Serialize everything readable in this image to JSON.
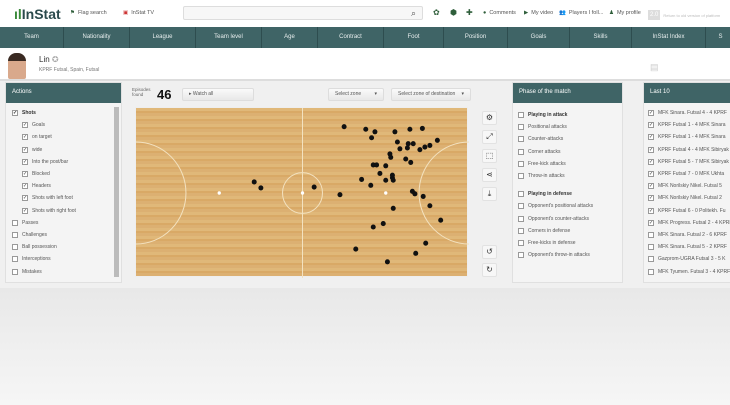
{
  "header": {
    "logo": "InStat",
    "flag_search": "Flag search",
    "instat_tv": "InStat TV",
    "comments": "Comments",
    "my_video": "My video",
    "players": "Players I foll...",
    "my_profile": "My profile",
    "return_old": "Return to old version of platform",
    "version_badge": "2.0"
  },
  "nav": [
    "Team",
    "Nationality",
    "League",
    "Team level",
    "Age",
    "Contract",
    "Foot",
    "Position",
    "Goals",
    "Skills",
    "InStat Index",
    "S"
  ],
  "player": {
    "name": "Lin",
    "club": "KPRF Futsal, Spain, Futsal"
  },
  "actions": {
    "title": "Actions",
    "items": [
      {
        "label": "Shots",
        "checked": true,
        "level": 0,
        "bold": true
      },
      {
        "label": "Goals",
        "checked": true,
        "level": 1
      },
      {
        "label": "on target",
        "checked": true,
        "level": 1
      },
      {
        "label": "wide",
        "checked": true,
        "level": 1
      },
      {
        "label": "Into the post/bar",
        "checked": true,
        "level": 1
      },
      {
        "label": "Blocked",
        "checked": true,
        "level": 1
      },
      {
        "label": "Headers",
        "checked": true,
        "level": 1
      },
      {
        "label": "Shots with left foot",
        "checked": true,
        "level": 1
      },
      {
        "label": "Shots with right foot",
        "checked": true,
        "level": 1
      },
      {
        "label": "Passes",
        "checked": false,
        "level": 0
      },
      {
        "label": "Challenges",
        "checked": false,
        "level": 0
      },
      {
        "label": "Ball possession",
        "checked": false,
        "level": 0
      },
      {
        "label": "Interceptions",
        "checked": false,
        "level": 0
      },
      {
        "label": "Mistakes",
        "checked": false,
        "level": 0
      }
    ]
  },
  "episodes": {
    "label": "Episodes found",
    "count": "46",
    "watch_all": "Watch all",
    "select_zone": "Select zone",
    "select_dest": "Select zone of destination"
  },
  "shots_m": [
    [
      25.0,
      2.2
    ],
    [
      27.6,
      2.5
    ],
    [
      28.7,
      2.8
    ],
    [
      28.3,
      3.5
    ],
    [
      31.1,
      2.8
    ],
    [
      32.9,
      2.5
    ],
    [
      34.4,
      2.4
    ],
    [
      36.2,
      3.8
    ],
    [
      35.3,
      4.4
    ],
    [
      34.7,
      4.6
    ],
    [
      34.1,
      4.9
    ],
    [
      33.3,
      4.2
    ],
    [
      32.7,
      4.2
    ],
    [
      32.6,
      4.7
    ],
    [
      31.7,
      4.8
    ],
    [
      31.4,
      4.0
    ],
    [
      30.5,
      5.4
    ],
    [
      30.6,
      5.8
    ],
    [
      32.4,
      6.0
    ],
    [
      33.0,
      6.4
    ],
    [
      28.5,
      6.7
    ],
    [
      28.9,
      6.7
    ],
    [
      30.0,
      6.8
    ],
    [
      29.3,
      7.7
    ],
    [
      27.1,
      8.4
    ],
    [
      28.2,
      9.1
    ],
    [
      30.0,
      8.5
    ],
    [
      30.8,
      8.2
    ],
    [
      30.9,
      8.5
    ],
    [
      21.4,
      9.3
    ],
    [
      24.5,
      10.2
    ],
    [
      33.2,
      9.8
    ],
    [
      33.5,
      10.1
    ],
    [
      34.5,
      10.4
    ],
    [
      35.3,
      11.5
    ],
    [
      30.9,
      11.8
    ],
    [
      36.6,
      13.2
    ],
    [
      29.7,
      13.6
    ],
    [
      28.5,
      14.0
    ],
    [
      34.8,
      15.9
    ],
    [
      33.6,
      17.1
    ],
    [
      26.4,
      16.6
    ],
    [
      30.2,
      18.1
    ],
    [
      14.2,
      8.7
    ],
    [
      15.0,
      9.4
    ],
    [
      30.8,
      7.9
    ]
  ],
  "phase": {
    "title": "Phase of the match",
    "items": [
      {
        "label": "Playing in attack",
        "bold": true
      },
      {
        "label": "Positional attacks"
      },
      {
        "label": "Counter-attacks"
      },
      {
        "label": "Corner attacks"
      },
      {
        "label": "Free-kick attacks"
      },
      {
        "label": "Throw-in attacks"
      },
      {
        "label": "",
        "gap": true
      },
      {
        "label": "Playing in defense",
        "bold": true
      },
      {
        "label": "Opponent's positional attacks"
      },
      {
        "label": "Opponent's counter-attacks"
      },
      {
        "label": "Corners in defense"
      },
      {
        "label": "Free-kicks in defense"
      },
      {
        "label": "Opponent's throw-in attacks"
      }
    ]
  },
  "last10": {
    "title": "Last 10",
    "items": [
      {
        "label": "MFK Sinara. Futsal 4 - 4 KPRF",
        "checked": true
      },
      {
        "label": "KPRF Futsal 1 - 4 MFK Sinara",
        "checked": true
      },
      {
        "label": "KPRF Futsal 1 - 4 MFK Sinara",
        "checked": true
      },
      {
        "label": "KPRF Futsal 4 - 4 MFK Sibiryak",
        "checked": true
      },
      {
        "label": "KPRF Futsal 5 - 7 MFK Sibiryak",
        "checked": true
      },
      {
        "label": "KPRF Futsal 7 - 0 MFK Ukhta",
        "checked": true
      },
      {
        "label": "MFK Norilskiy Nikel. Futsal 5",
        "checked": true
      },
      {
        "label": "MFK Norilskiy Nikel. Futsal 2",
        "checked": true
      },
      {
        "label": "KPRF Futsal 6 - 0 Politekh. Fu",
        "checked": true
      },
      {
        "label": "MFK Progress. Futsal 2 - 4 KPRF",
        "checked": true
      },
      {
        "label": "MFK Sinara. Futsal 2 - 6 KPRF",
        "checked": false
      },
      {
        "label": "MFK Sinara. Futsal 5 - 2 KPRF",
        "checked": false
      },
      {
        "label": "Gazprom-UGRA Futsal 3 - 5 K",
        "checked": false
      },
      {
        "label": "MFK Tyumen. Futsal 3 - 4 KPRF",
        "checked": false
      }
    ]
  }
}
